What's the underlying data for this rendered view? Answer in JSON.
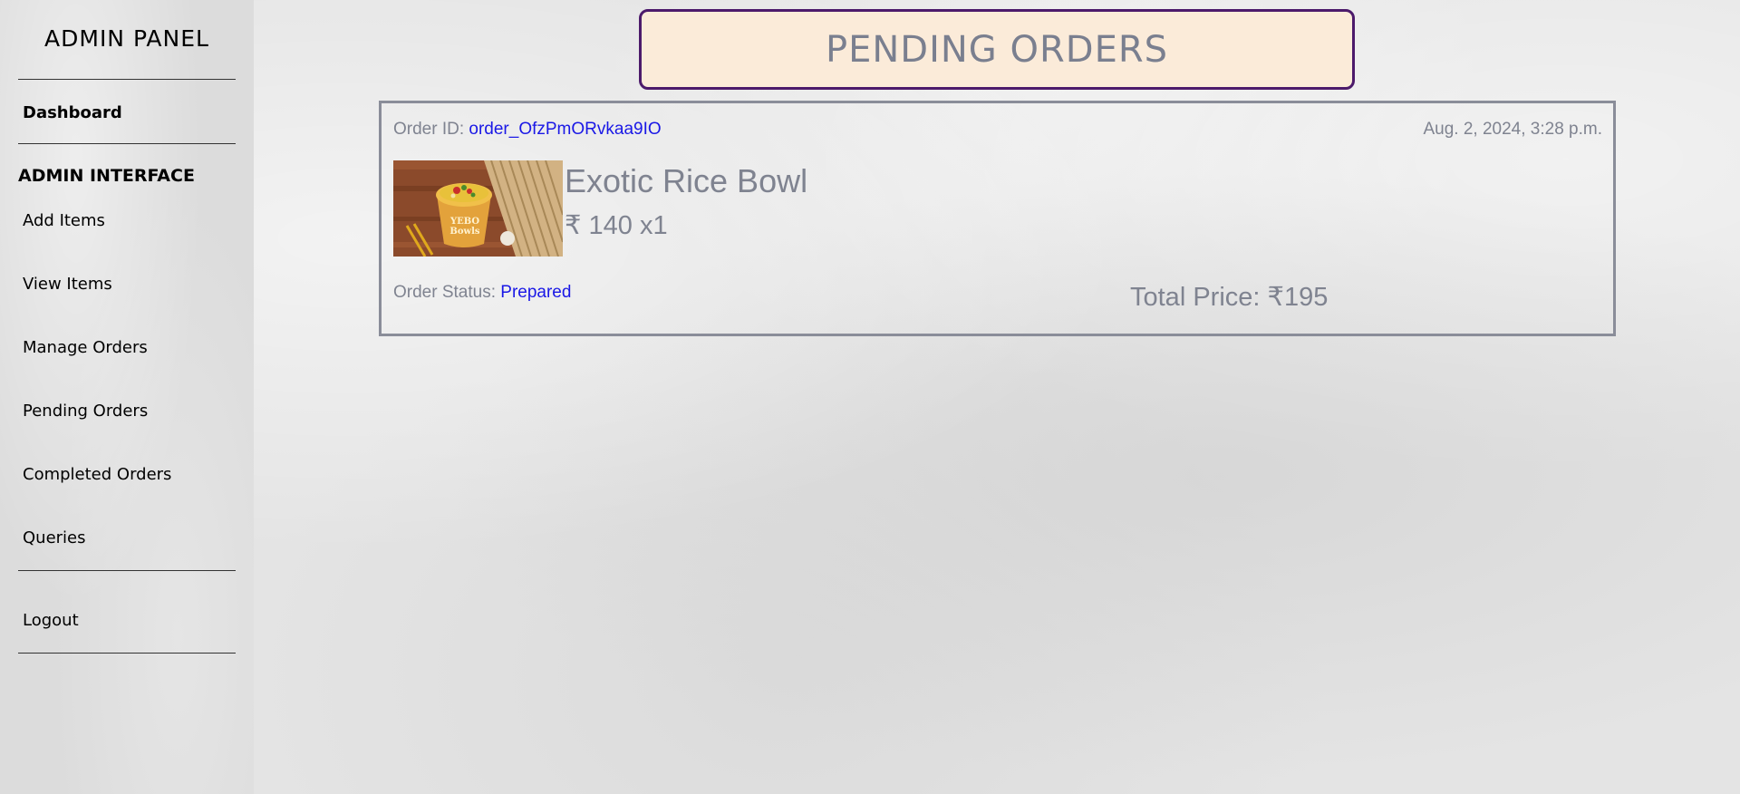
{
  "sidebar": {
    "title": "ADMIN PANEL",
    "dashboard": "Dashboard",
    "section_heading": "ADMIN INTERFACE",
    "items": [
      {
        "label": "Add Items"
      },
      {
        "label": "View Items"
      },
      {
        "label": "Manage Orders"
      },
      {
        "label": "Pending Orders"
      },
      {
        "label": "Completed Orders"
      },
      {
        "label": "Queries"
      }
    ],
    "logout": "Logout"
  },
  "header": {
    "title": "PENDING ORDERS"
  },
  "order": {
    "id_label": "Order ID:",
    "id_value": "order_OfzPmORvkaa9IO",
    "date": "Aug. 2, 2024, 3:28 p.m.",
    "item_name": "Exotic Rice Bowl",
    "item_price": "₹ 140 x1",
    "status_label": "Order Status:",
    "status_value": "Prepared",
    "total": "Total Price: ₹195",
    "image_text": "YEBO Bowls"
  },
  "colors": {
    "header_bg": "#fbebd9",
    "header_border": "#4c1a6b",
    "link_blue": "#1a18e6",
    "muted_text": "#7f8390"
  }
}
